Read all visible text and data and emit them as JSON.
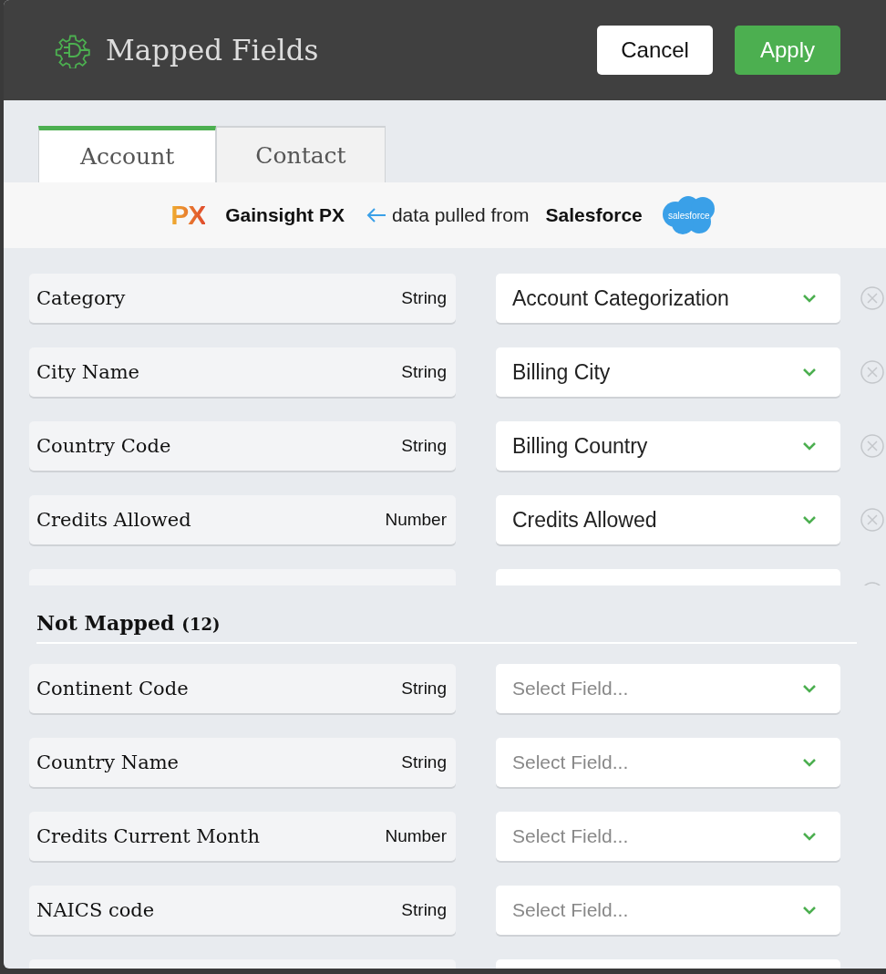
{
  "dialog": {
    "title": "Mapped Fields",
    "buttons": [
      {
        "label": "Cancel",
        "kind": "secondary"
      },
      {
        "label": "Apply",
        "kind": "primary"
      }
    ]
  },
  "tabs": [
    {
      "label": "Account",
      "selected": true
    },
    {
      "label": "Contact",
      "selected": false
    }
  ],
  "source_bar": {
    "target_logo": "PX",
    "target": "Gainsight PX",
    "connector": "data pulled from",
    "source": "Salesforce",
    "source_logo": "salesforce"
  },
  "mapped": [
    {
      "field": "Category",
      "type": "String",
      "value": "Account Categorization"
    },
    {
      "field": "City Name",
      "type": "String",
      "value": "Billing City"
    },
    {
      "field": "Country Code",
      "type": "String",
      "value": "Billing Country"
    },
    {
      "field": "Credits Allowed",
      "type": "Number",
      "value": "Credits Allowed"
    }
  ],
  "not_mapped": {
    "title": "Not Mapped",
    "count": "(12)",
    "rows": [
      {
        "field": "Continent Code",
        "type": "String",
        "placeholder": "Select Field..."
      },
      {
        "field": "Country Name",
        "type": "String",
        "placeholder": "Select Field..."
      },
      {
        "field": "Credits Current Month",
        "type": "Number",
        "placeholder": "Select Field..."
      },
      {
        "field": "NAICS code",
        "type": "String",
        "placeholder": "Select Field..."
      }
    ]
  }
}
